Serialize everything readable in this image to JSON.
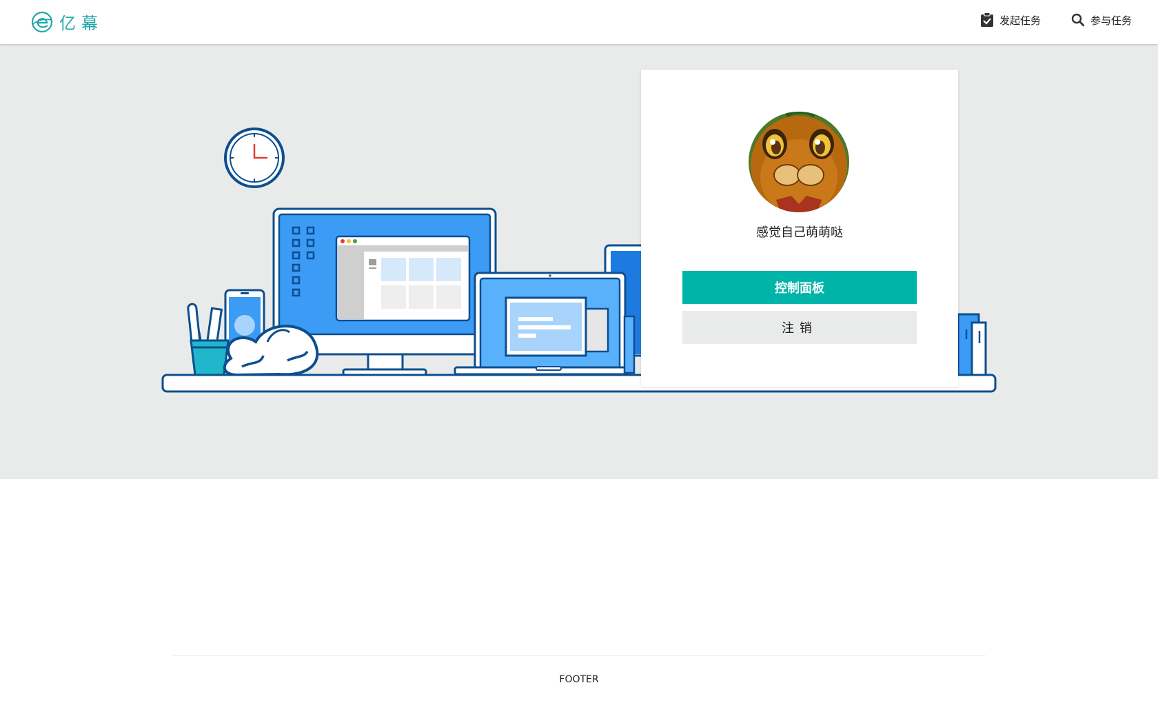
{
  "header": {
    "logo_text": "亿幕",
    "nav": [
      {
        "label": "发起任务",
        "icon": "clipboard-check-icon"
      },
      {
        "label": "参与任务",
        "icon": "search-icon"
      }
    ]
  },
  "user_card": {
    "username": "感觉自己萌萌哒",
    "avatar": "user-avatar",
    "primary_button": "控制面板",
    "secondary_button": "注销"
  },
  "footer": {
    "text": "FOOTER"
  },
  "colors": {
    "brand": "#1fa8a8",
    "primary_button": "#00b4aa",
    "hero_background": "#e9eaea",
    "illustration_blue": "#3b9bf5",
    "illustration_outline": "#0d4e8f"
  }
}
